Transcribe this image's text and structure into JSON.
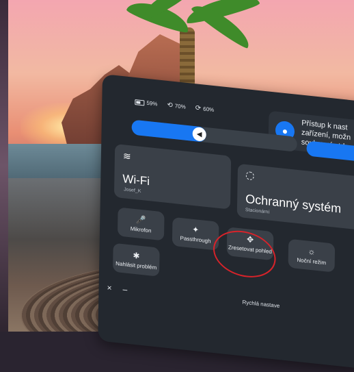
{
  "status": {
    "battery": "59%",
    "left_controller": "70%",
    "right_controller": "60%"
  },
  "notice": {
    "text_line1": "Přístup k nast",
    "text_line2": "zařízení, možn",
    "text_line3": "soukromí atd."
  },
  "volume": {
    "level_fraction": 0.45
  },
  "tiles": {
    "wifi": {
      "label": "Wi-Fi",
      "sub": "Josef_K"
    },
    "shield": {
      "label": "Ochranný systém",
      "sub": "Stacionární"
    }
  },
  "quick": [
    {
      "label": "Mikrofon",
      "icon": "mic-icon"
    },
    {
      "label": "Passthrough",
      "icon": "passthrough-icon"
    },
    {
      "label": "Zresetovat pohled",
      "icon": "move-icon"
    },
    {
      "label": "Noční režim",
      "icon": "sun-icon"
    },
    {
      "label": "Nahlásit problém",
      "icon": "bug-icon"
    }
  ],
  "footer": {
    "text": "Rychlá nastave",
    "close": "×",
    "minimize": "–"
  },
  "colors": {
    "accent": "#1877f2",
    "annotation_circle": "#d8232a"
  }
}
